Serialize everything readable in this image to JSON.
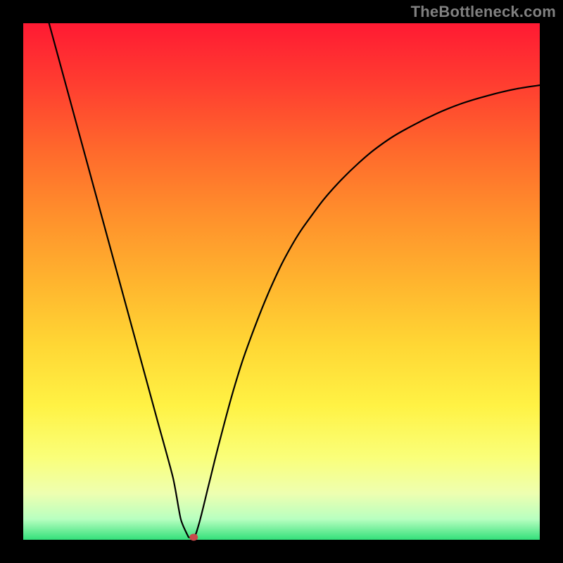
{
  "watermark": "TheBottleneck.com",
  "colors": {
    "frame_bg": "#000000",
    "watermark_text": "#808080",
    "curve_stroke": "#000000",
    "dot_fill": "#c94a4a"
  },
  "chart_data": {
    "type": "line",
    "title": "",
    "xlabel": "",
    "ylabel": "",
    "xlim": [
      0,
      100
    ],
    "ylim": [
      0,
      100
    ],
    "grid": false,
    "legend": false,
    "series": [
      {
        "name": "bottleneck-curve",
        "x": [
          5,
          8,
          11,
          14,
          17,
          20,
          23,
          26,
          29,
          30.5,
          32,
          33,
          34,
          36,
          38,
          41,
          44,
          48,
          52,
          56,
          60,
          65,
          70,
          75,
          80,
          85,
          90,
          95,
          100
        ],
        "y": [
          100,
          89,
          78,
          67,
          56,
          45,
          34,
          23,
          12,
          4,
          0.5,
          0.5,
          3,
          11,
          19,
          30,
          39,
          49,
          57,
          63,
          68,
          73,
          77,
          80,
          82.5,
          84.5,
          86,
          87.2,
          88
        ]
      }
    ],
    "marker": {
      "x": 33,
      "y": 0.5
    },
    "gradient_stops": [
      {
        "pct": 0,
        "color": "#ff1a33"
      },
      {
        "pct": 12,
        "color": "#ff3e30"
      },
      {
        "pct": 25,
        "color": "#ff6a2c"
      },
      {
        "pct": 37,
        "color": "#ff8f2c"
      },
      {
        "pct": 50,
        "color": "#ffb42e"
      },
      {
        "pct": 62,
        "color": "#ffd634"
      },
      {
        "pct": 74,
        "color": "#fff244"
      },
      {
        "pct": 84,
        "color": "#faff79"
      },
      {
        "pct": 91,
        "color": "#eeffb0"
      },
      {
        "pct": 96,
        "color": "#b8ffc0"
      },
      {
        "pct": 100,
        "color": "#33e07a"
      }
    ]
  }
}
